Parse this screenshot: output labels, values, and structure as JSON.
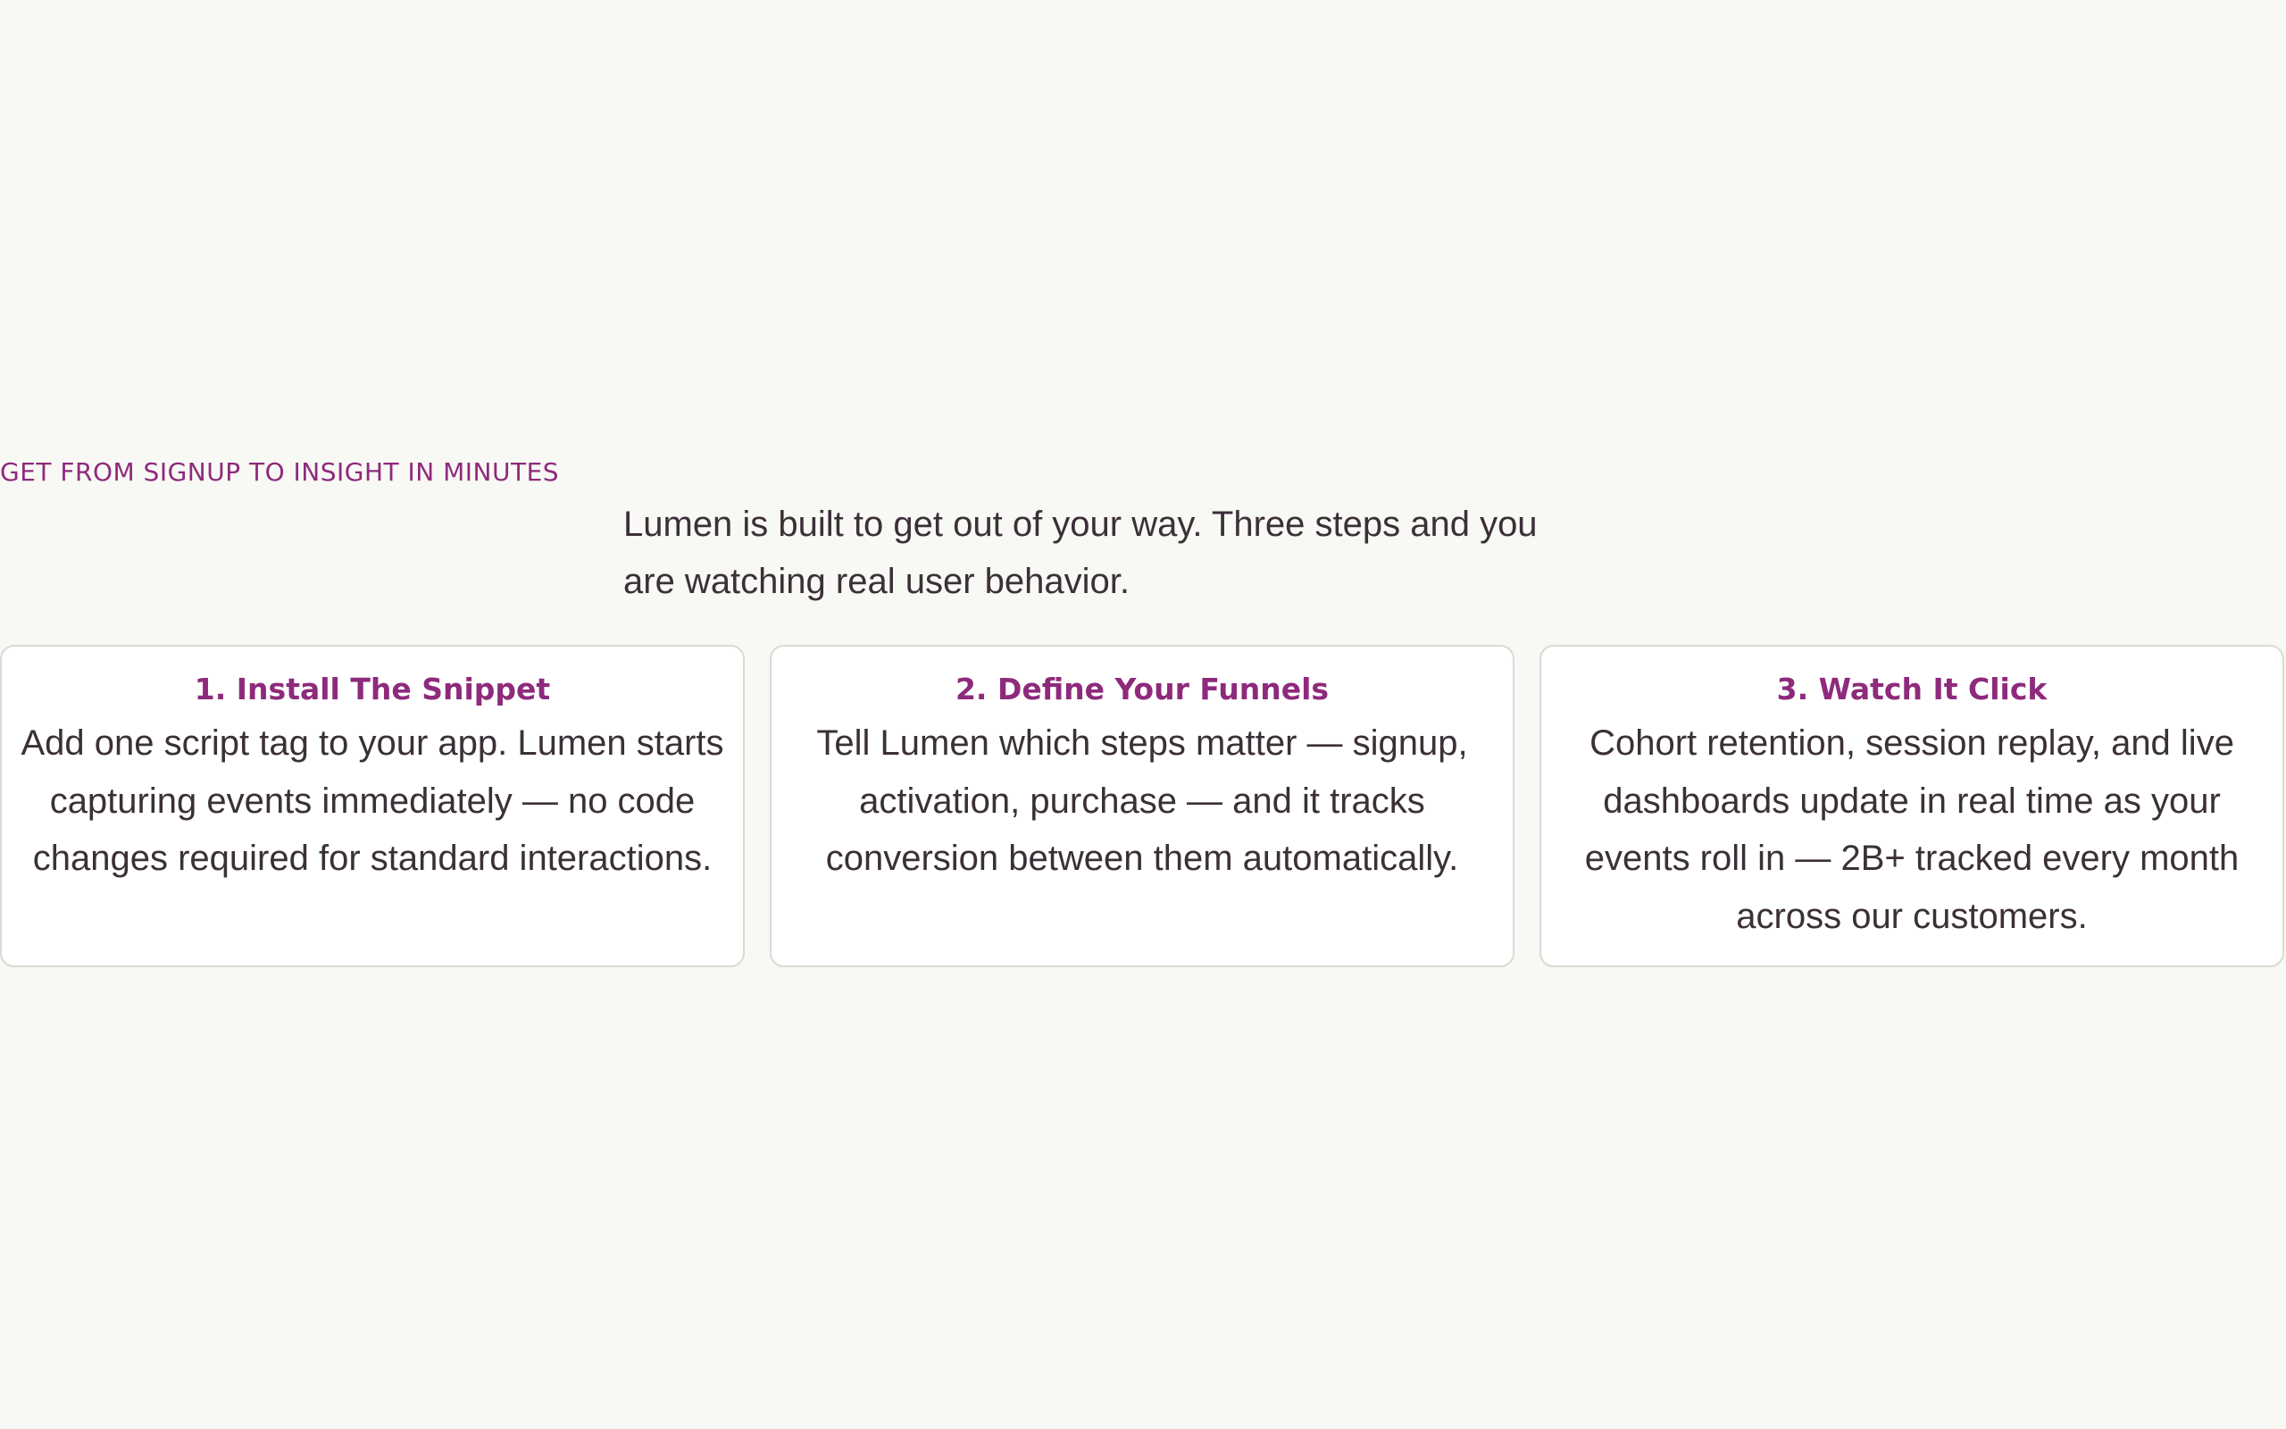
{
  "section": {
    "eyebrow": "GET FROM SIGNUP TO INSIGHT IN MINUTES",
    "lead": "Lumen is built to get out of your way. Three steps and you are watching real user behavior."
  },
  "steps": [
    {
      "title": "1. Install The Snippet",
      "body": "Add one script tag to your app. Lumen starts capturing events immediately — no code changes required for standard interactions."
    },
    {
      "title": "2. Define Your Funnels",
      "body": "Tell Lumen which steps matter — signup, activation, purchase — and it tracks conversion between them automatically."
    },
    {
      "title": "3. Watch It Click",
      "body": "Cohort retention, session replay, and live dashboards update in real time as your events roll in — 2B+ tracked every month across our customers."
    }
  ],
  "colors": {
    "accent": "#8e2a7c",
    "text": "#3b3038",
    "background": "#f8f8f4",
    "card_border": "#dcd9d3"
  }
}
